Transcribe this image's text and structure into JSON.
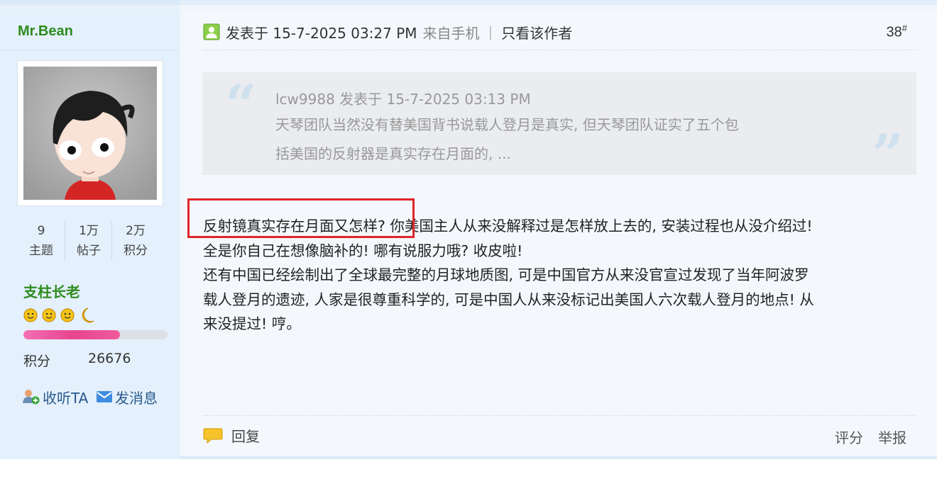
{
  "author": {
    "name": "Mr.Bean",
    "stats": [
      {
        "value": "9",
        "label": "主题"
      },
      {
        "value": "1万",
        "label": "帖子"
      },
      {
        "value": "2万",
        "label": "积分"
      }
    ],
    "rank": "支柱长老",
    "rank_progress": 0.67,
    "points_label": "积分",
    "points_value": "26676",
    "follow_label": "收听TA",
    "message_label": "发消息"
  },
  "post": {
    "meta_prefix": "发表于 15-7-2025 03:27 PM",
    "source": "来自手机",
    "separator": "|",
    "only_author": "只看该作者",
    "floor": "38",
    "floor_mark": "#",
    "quote": {
      "header": "lcw9988 发表于 15-7-2025 03:13 PM",
      "line1": "天琴团队当然没有替美国背书说载人登月是真实, 但天琴团队证实了五个包",
      "line2": "括美国的反射器是真实存在月面的, ..."
    },
    "body_lines": [
      "反射镜真实存在月面又怎样? 你美国主人从来没解释过是怎样放上去的, 安装过程也从没介绍过!",
      "全是你自己在想像脑补的! 哪有说服力哦? 收皮啦!",
      "还有中国已经绘制出了全球最完整的月球地质图, 可是中国官方从来没官宣过发现了当年阿波罗",
      "载人登月的遗迹, 人家是很尊重科学的, 可是中国人从来没标记出美国人六次载人登月的地点! 从",
      "来没提过! 哼。"
    ],
    "reply_label": "回复",
    "rate_label": "评分",
    "report_label": "举报"
  },
  "colors": {
    "author_green": "#2e8b1e",
    "highlight_red": "#e0242c",
    "sidebar_bg": "#e4f0fc",
    "link_blue": "#285a8c"
  }
}
